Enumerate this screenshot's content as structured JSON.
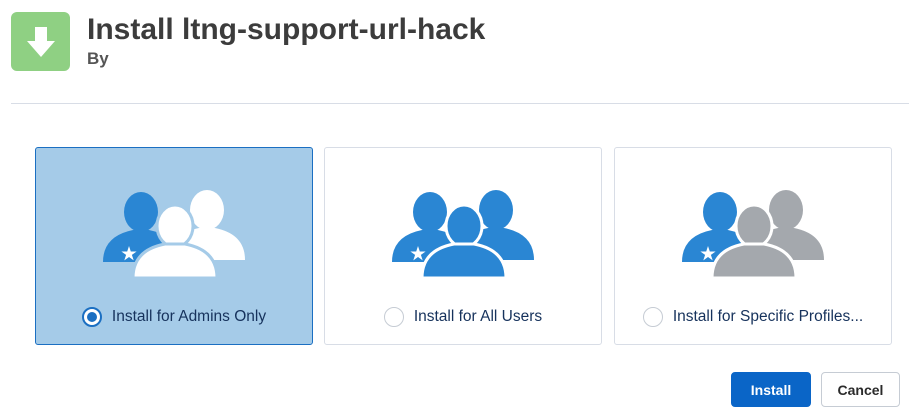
{
  "header": {
    "title": "Install ltng-support-url-hack",
    "subtitle": "By",
    "icon": "download-arrow-icon",
    "icon_color": "#8fd083"
  },
  "options": [
    {
      "label": "Install for Admins Only",
      "selected": true,
      "icon": "admin-users-icon",
      "other_people_color": "#ffffff"
    },
    {
      "label": "Install for All Users",
      "selected": false,
      "icon": "all-users-icon",
      "other_people_color": "#2a86d3"
    },
    {
      "label": "Install for Specific Profiles...",
      "selected": false,
      "icon": "specific-profiles-icon",
      "other_people_color": "#a4a8ad"
    }
  ],
  "buttons": {
    "install": "Install",
    "cancel": "Cancel"
  },
  "colors": {
    "accent": "#0a65c7",
    "admin_person": "#2a86d3",
    "selected_card": "#a5cbe8"
  }
}
